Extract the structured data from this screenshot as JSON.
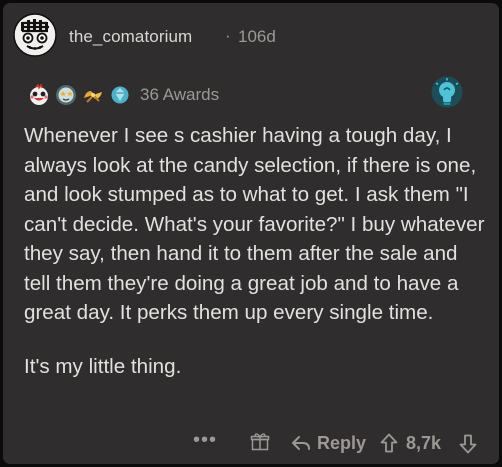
{
  "comment": {
    "username": "the_comatorium",
    "separator": "·",
    "age": "106d",
    "awards": {
      "icons": [
        "wholesome-award-icon",
        "star-eyes-award-icon",
        "hands-award-icon",
        "diamond-award-icon"
      ],
      "count_label": "36 Awards"
    },
    "badge_icon": "lightbulb-icon",
    "body": [
      "Whenever I see s cashier having a tough day, I always look at the candy selection, if there is one, and look stumped as to what to get. I ask them \"I can't decide. What's your favorite?\" I buy whatever they say, then hand it to them after the sale and tell them they're doing a great job and to have a great day. It perks them up every single time.",
      "It's my little thing."
    ]
  },
  "actions": {
    "more_label": "•••",
    "reply_label": "Reply",
    "score": "8,7k"
  },
  "colors": {
    "background": "#0c0b0b",
    "card": "#2f2d2e",
    "text": "#e3e0de",
    "muted": "#9c9895",
    "bulb": "#4fc3d8"
  }
}
